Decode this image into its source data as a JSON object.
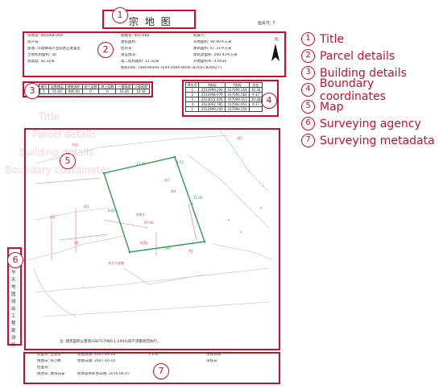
{
  "page_no": "图关号: 7",
  "title": "宗 地 图",
  "parcel": {
    "row1": [
      "宗地号: 065068-009",
      "图幅号: 065-068",
      "权属人:"
    ],
    "row2": [
      "房产号:",
      "建筑面积:",
      "宗地面积: 90.90平方米"
    ],
    "row3": [
      "座落: 玛瑙镇海沙业成协正发置区",
      "结宗号:",
      "建筑面积: 67.31平方米"
    ],
    "row4": [
      "土地利用面积: 30",
      "发证情况:",
      "建筑总面积: 290.93平方米"
    ],
    "row5": [
      "总高度: 42.32米",
      "第二结构面积: 13.32米",
      "开地面积率: 0.0036"
    ],
    "row6": "图形ID号: {846000A0-7E09-446A-8000-3EA5FC826627}",
    "north": "北"
  },
  "building": {
    "headers": [
      "幢号",
      "层数楼层",
      "建筑面积",
      "地下层数",
      "地上层数",
      "一楼高度",
      "二楼高度"
    ],
    "rows": [
      [
        "1",
        "01-02",
        "090.00",
        "0",
        "0",
        "10.36",
        "10.36"
      ]
    ]
  },
  "boundary": {
    "headers": [
      "界址号",
      "X坐标",
      "Y坐标",
      "边长"
    ],
    "rows": [
      [
        "1",
        "2512999.200",
        "417094.254",
        "10.36"
      ],
      [
        "2",
        "2512998.976",
        "417091.564",
        "9.37"
      ],
      [
        "3",
        "2513011.426",
        "417099.313",
        "10.36"
      ],
      [
        "4",
        "2513002.785",
        "417092.651",
        "9.37"
      ],
      [
        "1",
        "2512999.200",
        "417094.254",
        ""
      ]
    ]
  },
  "map": {
    "note": "注: 建筑面积以量测(GB/T17986.1-2000)房产测量规范执行。",
    "labels": [
      "东风",
      "机2",
      "机1",
      "机3",
      "机4",
      "机5",
      "宅J",
      "档案J",
      "宗地1",
      "东方大道路",
      "90.90",
      "宅J",
      "13.20",
      "11.00",
      "7.99",
      "8.00",
      "8.52"
    ]
  },
  "agency": "华天地图测绘工程勘测所",
  "metadata": {
    "rows": [
      [
        "测量员: 王志军",
        "绘图日期: 2007-09-18",
        "1:150",
        "审核日期:"
      ],
      [
        "绘图员: 陈小彬",
        "绘图日期: 2007-10-10",
        "",
        "审核员:"
      ],
      [
        "检查员:",
        "",
        "",
        ""
      ],
      [
        "修改员: 欧阳日安",
        "修改遗失补办日期: 2016-06-07",
        "",
        ""
      ]
    ]
  },
  "legend": [
    "Title",
    "Parcel details",
    "Building details",
    "Boundary coordinates",
    "Map",
    "Surveying agency",
    "Surveying metadata"
  ],
  "overlay_text": [
    "Title",
    "Parcel details",
    "Building details",
    "Boundary coordinates"
  ],
  "colors": {
    "annotation": "#c8102e",
    "parcel": "#2e9e4f",
    "boundary_line": "#e06fb0"
  }
}
